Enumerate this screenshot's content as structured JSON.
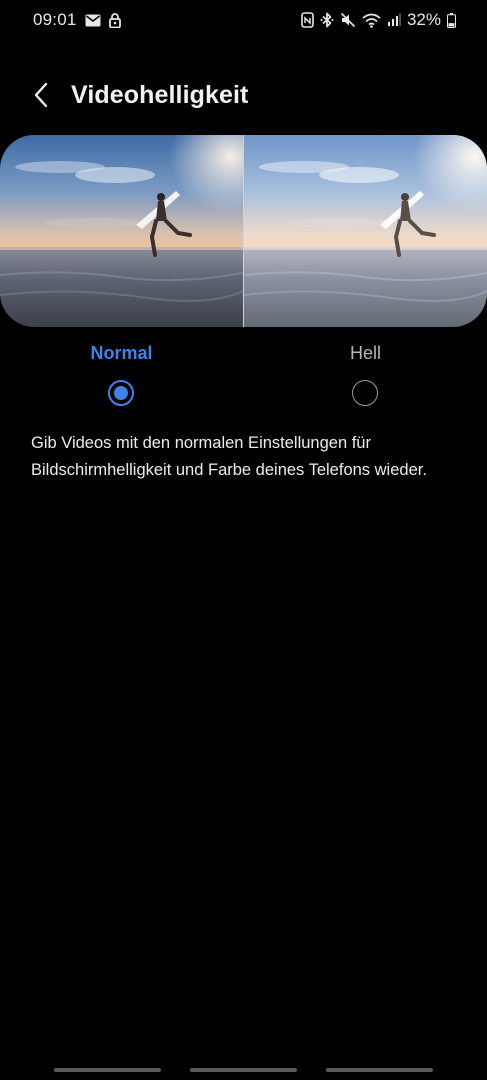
{
  "status_bar": {
    "time": "09:01",
    "left_icons": [
      "mail-icon",
      "lock-icon"
    ],
    "right_icons": [
      "nfc-icon",
      "bluetooth-icon",
      "mute-icon",
      "wifi-icon",
      "signal-icon"
    ],
    "battery_text": "32%",
    "battery_level": 0.32
  },
  "header": {
    "title": "Videohelligkeit",
    "back_icon": "back-chevron-icon"
  },
  "preview": {
    "left_image": "surfer-beach-normal",
    "right_image": "surfer-beach-bright"
  },
  "options": [
    {
      "label": "Normal",
      "selected": true
    },
    {
      "label": "Hell",
      "selected": false
    }
  ],
  "description": "Gib Videos mit den normalen Einstellungen für Bildschirmhelligkeit und Farbe deines Telefons wieder.",
  "colors": {
    "background": "#000000",
    "accent": "#3f82ea",
    "text": "#f2f2f2",
    "muted": "#b6b6b6"
  }
}
